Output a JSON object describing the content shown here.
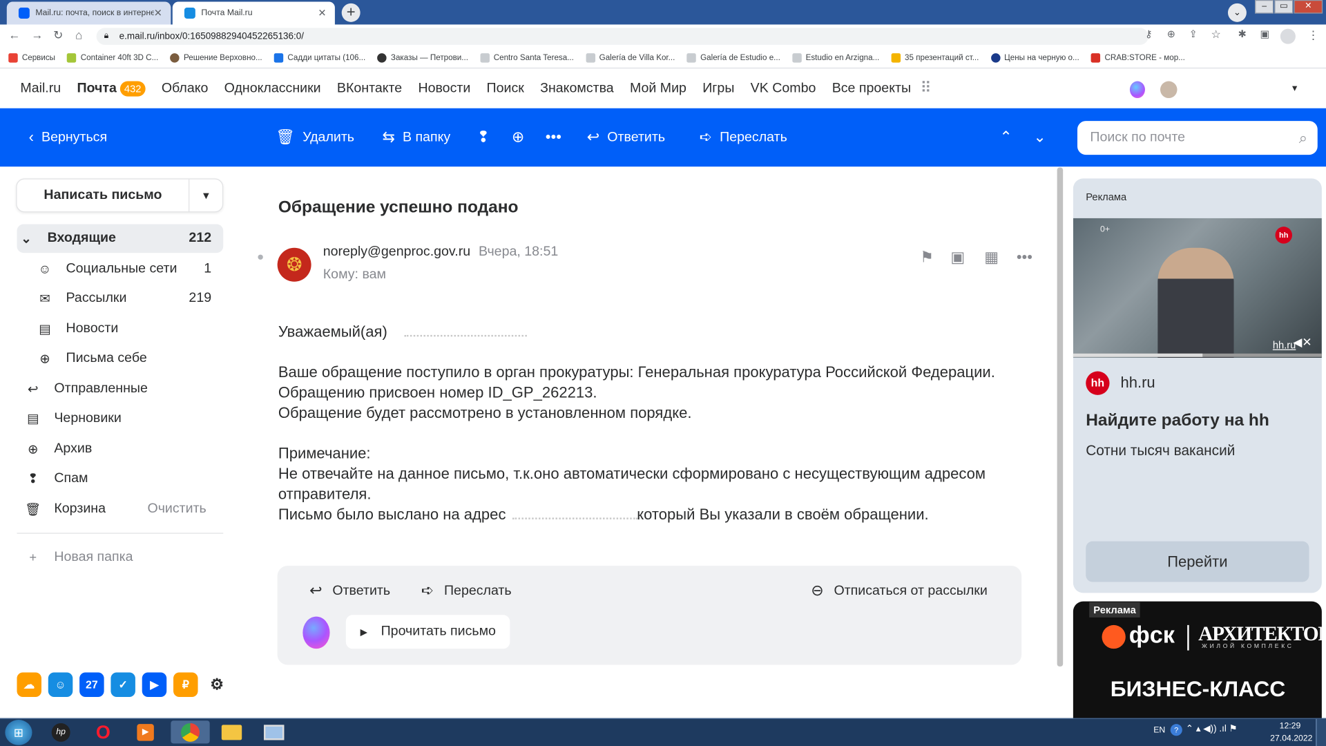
{
  "browser": {
    "tabs": [
      {
        "title": "Mail.ru: почта, поиск в интернет",
        "fav_color": "#005ff9"
      },
      {
        "title": "Почта Mail.ru",
        "fav_color": "#168de2"
      }
    ],
    "url": "e.mail.ru/inbox/0:16509882940452265136:0/",
    "bookmarks": [
      {
        "label": "Сервисы",
        "color": "#e94235"
      },
      {
        "label": "Container 40ft 3D C...",
        "color": "#a4c639"
      },
      {
        "label": "Решение Верховно...",
        "color": "#7a5c3e"
      },
      {
        "label": "Садди цитаты (106...",
        "color": "#1a73e8"
      },
      {
        "label": "Заказы — Петрови...",
        "color": "#333333"
      },
      {
        "label": "Centro Santa Teresa...",
        "color": "#9aa0a6"
      },
      {
        "label": "Galería de Villa Kor...",
        "color": "#9aa0a6"
      },
      {
        "label": "Galería de Estudio e...",
        "color": "#9aa0a6"
      },
      {
        "label": "Estudio en Arzigna...",
        "color": "#9aa0a6"
      },
      {
        "label": "35 презентаций ст...",
        "color": "#f4b400"
      },
      {
        "label": "Цены на черную о...",
        "color": "#1a3a8a"
      },
      {
        "label": "CRAB:STORE - мор...",
        "color": "#d93025"
      }
    ]
  },
  "topnav": {
    "logo": "Mail.ru",
    "mail": "Почта",
    "mail_count": "432",
    "items": [
      "Облако",
      "Одноклассники",
      "ВКонтакте",
      "Новости",
      "Поиск",
      "Знакомства",
      "Мой Мир",
      "Игры",
      "VK Combo",
      "Все проекты"
    ]
  },
  "toolbar": {
    "back": "Вернуться",
    "delete": "Удалить",
    "to_folder": "В папку",
    "reply": "Ответить",
    "forward": "Переслать",
    "search_placeholder": "Поиск по почте"
  },
  "sidebar": {
    "compose": "Написать письмо",
    "folders": [
      {
        "label": "Входящие",
        "count": "212",
        "icon": "chevron-down-icon"
      },
      {
        "label": "Социальные сети",
        "count": "1",
        "icon": "people-icon"
      },
      {
        "label": "Рассылки",
        "count": "219",
        "icon": "newsletter-icon"
      },
      {
        "label": "Новости",
        "count": "",
        "icon": "news-icon"
      },
      {
        "label": "Письма себе",
        "count": "",
        "icon": "self-mail-icon"
      },
      {
        "label": "Отправленные",
        "count": "",
        "icon": "sent-icon"
      },
      {
        "label": "Черновики",
        "count": "",
        "icon": "drafts-icon"
      },
      {
        "label": "Архив",
        "count": "",
        "icon": "archive-icon"
      },
      {
        "label": "Спам",
        "count": "",
        "icon": "spam-icon"
      },
      {
        "label": "Корзина",
        "count": "",
        "icon": "trash-icon"
      }
    ],
    "trash_clear": "Очистить",
    "new_folder": "Новая папка"
  },
  "letter": {
    "subject": "Обращение успешно подано",
    "from": "noreply@genproc.gov.ru",
    "date": "Вчера, 18:51",
    "to_label": "Кому:",
    "to_value": "вам",
    "body": [
      "Уважаемый(ая)",
      "",
      "Ваше обращение поступило в орган прокуратуры: Генеральная прокуратура Российской Федерации.",
      "Обращению присвоен номер ID_GP_262213.",
      "Обращение будет рассмотрено в установленном порядке.",
      "",
      "Примечание:",
      "Не отвечайте на данное письмо, т.к.оно автоматически сформировано с несуществующим адресом",
      "отправителя.",
      "Письмо было выслано на адрес",
      "который Вы указали в своём обращении."
    ],
    "reply": "Ответить",
    "forward": "Переслать",
    "unsubscribe": "Отписаться от рассылки",
    "read_aloud": "Прочитать письмо"
  },
  "ads": {
    "label": "Реклама",
    "age": "0+",
    "video_link": "hh.ru",
    "brand": "hh.ru",
    "brand_logo": "hh",
    "headline": "Найдите работу на hh",
    "subline": "Сотни тысяч вакансий",
    "cta": "Перейти",
    "ad2_label": "Реклама",
    "ad2_brand": "фск",
    "ad2_project": "АРХИТЕКТОР",
    "ad2_project_sub": "ЖИЛОЙ КОМПЛЕКС",
    "ad2_class": "БИЗНЕС-КЛАСС"
  },
  "taskbar": {
    "lang": "EN",
    "time": "12:29",
    "date": "27.04.2022"
  }
}
